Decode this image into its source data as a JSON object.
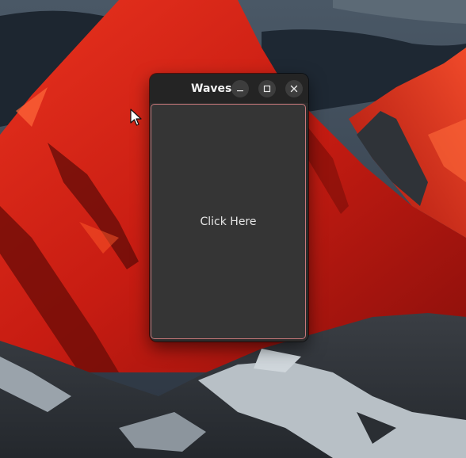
{
  "window": {
    "title": "Waves",
    "minimize_icon": "minimize-icon",
    "maximize_icon": "maximize-icon",
    "close_icon": "close-icon"
  },
  "content": {
    "button_label": "Click Here"
  },
  "colors": {
    "accent_border": "#c8787a",
    "titlebar": "#242424",
    "button_bg": "#353535"
  }
}
